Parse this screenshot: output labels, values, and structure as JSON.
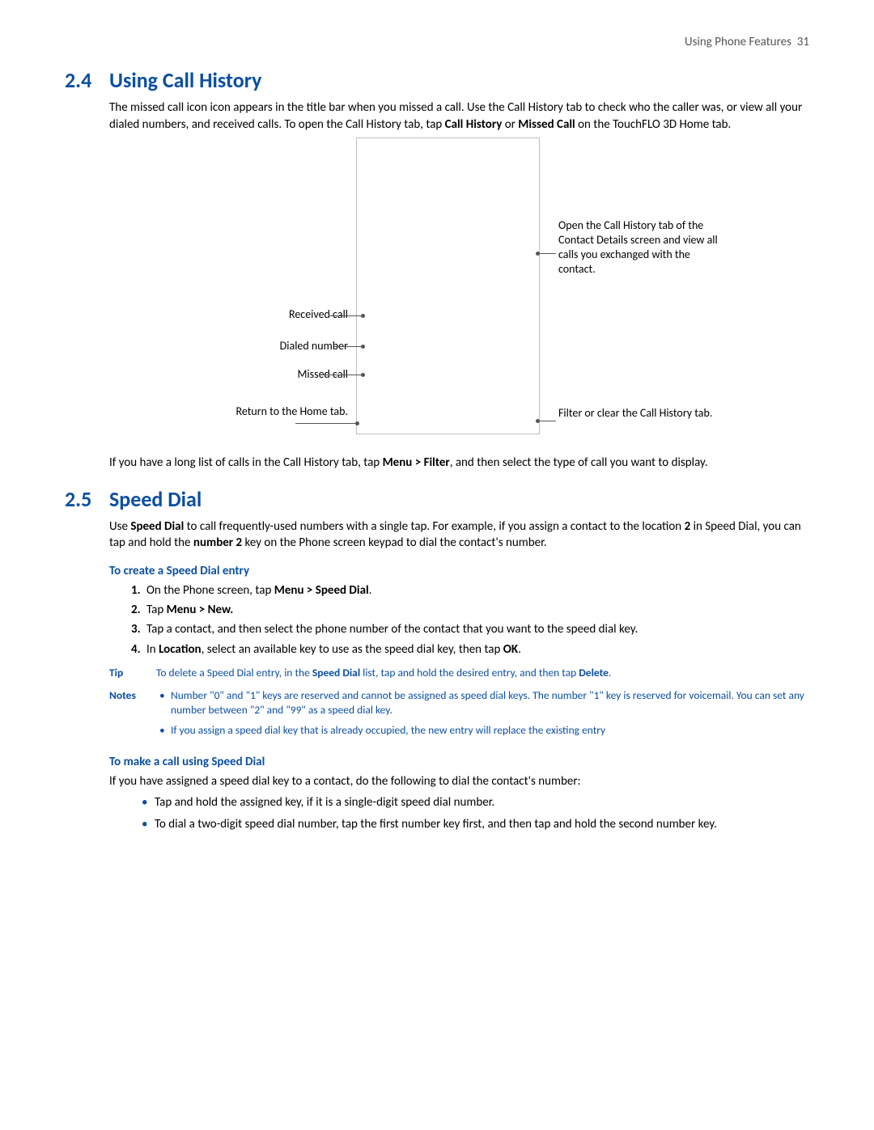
{
  "header": {
    "chapter": "Using Phone Features",
    "page": "31"
  },
  "sections": {
    "s24": {
      "num": "2.4",
      "title": "Using Call History",
      "intro_html": "The missed call icon icon appears in the title bar when you missed a call. Use the Call History tab to check who the caller was, or view all your dialed numbers, and received calls. To open the Call History tab, tap <b>Call History</b> or <b>Missed Call</b> on the TouchFLO 3D Home tab.",
      "callouts": {
        "received": "Received call",
        "dialed": "Dialed number",
        "missed": "Missed call",
        "return_home": "Return to the Home tab.",
        "open_tab": "Open the Call History tab of the Contact Details screen and view all calls you exchanged with the contact.",
        "filter": "Filter or clear the Call History tab."
      },
      "para2_html": "If you have a long list of calls in the Call History tab, tap <b>Menu > Filter</b>, and then select the type of call you want to display."
    },
    "s25": {
      "num": "2.5",
      "title": "Speed Dial",
      "intro_html": "Use <b>Speed Dial</b> to call frequently-used numbers with a single tap. For example, if you assign a contact to the location <b>2</b> in Speed Dial, you can tap and hold the <b>number 2</b> key on the Phone screen keypad to dial the contact's number.",
      "sub_create": "To create a Speed Dial entry",
      "steps": [
        "On the Phone screen, tap <b>Menu > Speed Dial</b>.",
        "Tap <b>Menu > New.</b>",
        "Tap a contact, and then select the phone number of the contact that you want to the speed dial key.",
        "In <b>Location</b>, select an available key to use as the speed dial key, then tap <b>OK</b>."
      ],
      "tip_label": "Tip",
      "tip_html": "To delete a Speed Dial entry, in the <b>Speed Dial</b> list, tap and hold the desired entry, and then tap <b>Delete</b>.",
      "notes_label": "Notes",
      "notes": [
        "Number \"0\" and \"1\" keys are reserved and cannot be assigned as speed dial keys. The number \"1\" key is reserved for voicemail. You can set any number between \"2\" and \"99\" as a speed dial key.",
        "If you assign a speed dial key that is already occupied, the new entry will replace the existing entry"
      ],
      "sub_make": "To make a call using Speed Dial",
      "make_intro": "If you have assigned a speed dial key to a contact, do the following to dial the contact's number:",
      "make_bullets": [
        "Tap and hold the assigned key, if it is a single-digit speed dial number.",
        "To dial a two-digit speed dial number, tap the first number key first, and then tap and hold the second number key."
      ]
    }
  }
}
